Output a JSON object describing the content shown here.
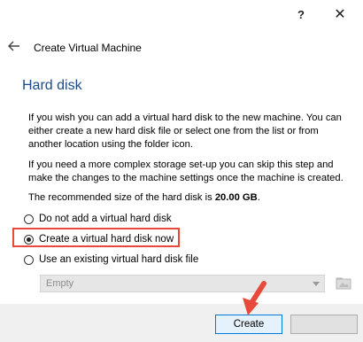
{
  "window": {
    "help_label": "?",
    "close_label": "✕"
  },
  "header": {
    "title": "Create Virtual Machine"
  },
  "page": {
    "section_title": "Hard disk",
    "description_1": "If you wish you can add a virtual hard disk to the new machine. You can either create a new hard disk file or select one from the list or from another location using the folder icon.",
    "description_2": "If you need a more complex storage set-up you can skip this step and make the changes to the machine settings once the machine is created.",
    "recommended_prefix": "The recommended size of the hard disk is ",
    "recommended_size": "20.00 GB",
    "recommended_suffix": "."
  },
  "options": [
    {
      "label": "Do not add a virtual hard disk",
      "selected": false
    },
    {
      "label": "Create a virtual hard disk now",
      "selected": true
    },
    {
      "label": "Use an existing virtual hard disk file",
      "selected": false
    }
  ],
  "existing_disk_select": {
    "value": "Empty",
    "disabled": true
  },
  "footer": {
    "create_label": "Create",
    "cancel_label": ""
  },
  "colors": {
    "section_title": "#1a4a8a",
    "highlight": "#e8493a",
    "primary_button_border": "#0078d7"
  },
  "icons": {
    "back": "back-arrow-icon",
    "folder": "folder-icon",
    "annotation": "red-arrow-icon"
  }
}
